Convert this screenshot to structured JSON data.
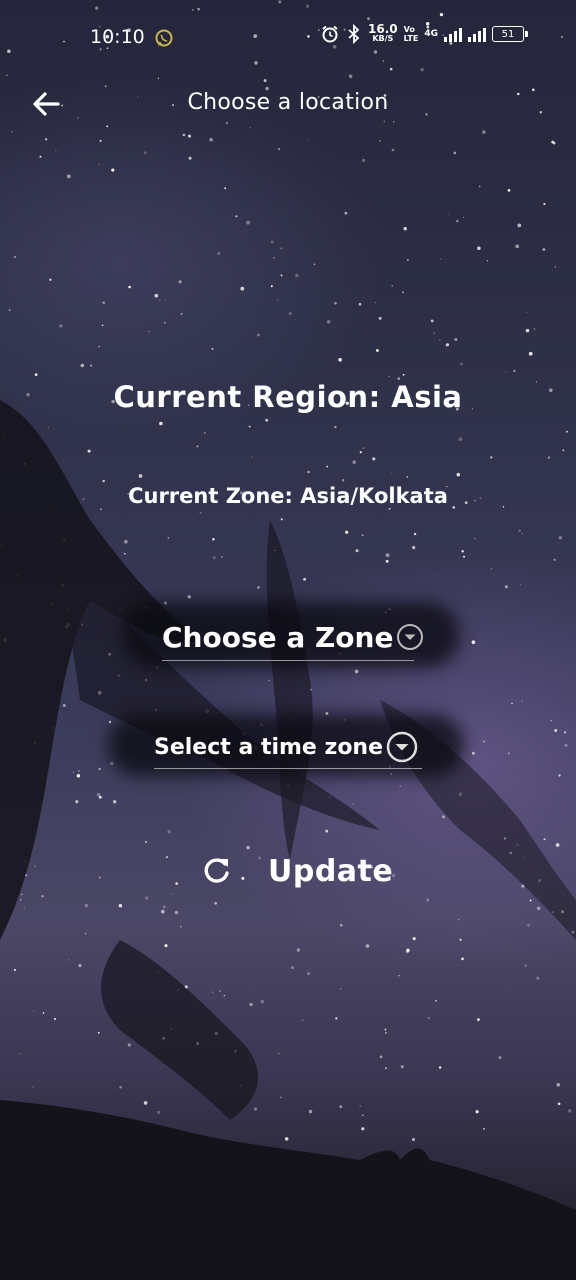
{
  "status_bar": {
    "time": "10:10",
    "net_speed_value": "16.0",
    "net_speed_unit": "KB/S",
    "volte_top": "Vo",
    "volte_bottom": "LTE",
    "network": "4G",
    "battery": "51",
    "icons": [
      "whatsapp-icon",
      "alarm-icon",
      "bluetooth-icon",
      "signal-icon",
      "battery-icon"
    ]
  },
  "app_bar": {
    "title": "Choose a location",
    "back_icon": "arrow-left-icon"
  },
  "main": {
    "current_region": "Current Region: Asia",
    "current_zone": "Current Zone: Asia/Kolkata",
    "zone_dropdown": {
      "label": "Choose a Zone",
      "icon": "chevron-down-circle-icon"
    },
    "timezone_dropdown": {
      "label": "Select a time zone",
      "icon": "chevron-down-circle-icon"
    },
    "update_button": {
      "label": "Update",
      "icon": "refresh-icon"
    }
  },
  "colors": {
    "text": "#ffffff",
    "sky_top": "#25263b",
    "sky_mid": "#3a3a5a",
    "ground": "#1b1a22"
  }
}
